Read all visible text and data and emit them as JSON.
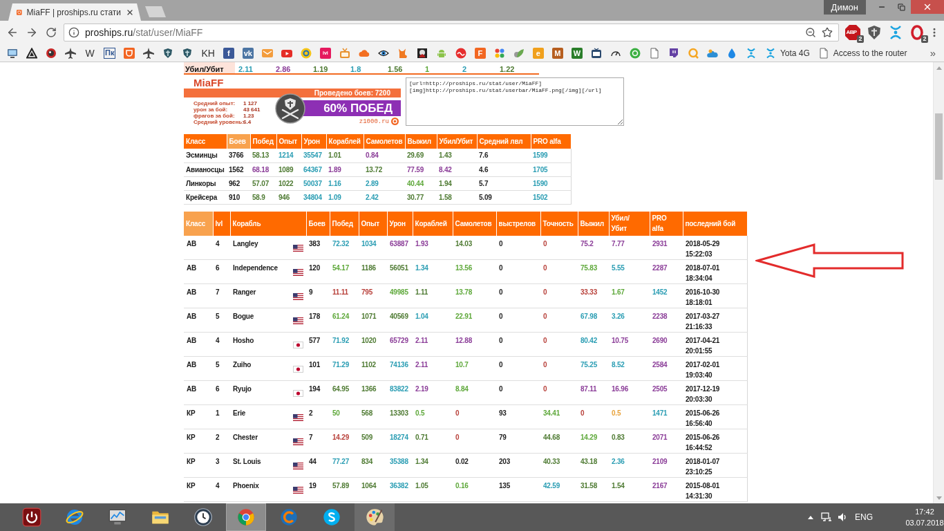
{
  "browser": {
    "tabs": [
      {
        "title": "MiaFF | proships.ru стати",
        "selected": true
      }
    ],
    "profile": "Димон",
    "address": {
      "host": "proships.ru",
      "path": "/stat/user/MiaFF"
    },
    "extensions": [
      {
        "kind": "badged",
        "label": "ABP",
        "badge": "2"
      },
      {
        "kind": "plain"
      },
      {
        "kind": "plain"
      },
      {
        "kind": "badged",
        "badge": "2"
      }
    ],
    "bookmarks": [
      {
        "kind": "icon"
      },
      {
        "kind": "icon"
      },
      {
        "kind": "icon"
      },
      {
        "kind": "icon"
      },
      {
        "kind": "letter",
        "label": "W"
      },
      {
        "kind": "boxed",
        "label": "Пк",
        "color": "#2c5390"
      },
      {
        "kind": "icon"
      },
      {
        "kind": "icon"
      },
      {
        "kind": "icon"
      },
      {
        "kind": "icon"
      },
      {
        "kind": "letter",
        "label": "KH"
      },
      {
        "kind": "tile",
        "label": "f",
        "color": "#3b5998"
      },
      {
        "kind": "tile",
        "label": "vk",
        "color": "#4c75a3"
      },
      {
        "kind": "icon"
      },
      {
        "kind": "icon"
      },
      {
        "kind": "icon"
      },
      {
        "kind": "tile",
        "label": "ivi",
        "color": "#e5195e"
      },
      {
        "kind": "icon"
      },
      {
        "kind": "icon"
      },
      {
        "kind": "icon"
      },
      {
        "kind": "icon"
      },
      {
        "kind": "icon"
      },
      {
        "kind": "icon"
      },
      {
        "kind": "icon"
      },
      {
        "kind": "tile",
        "label": "F",
        "color": "#f26722"
      },
      {
        "kind": "icon"
      },
      {
        "kind": "icon"
      },
      {
        "kind": "tile",
        "label": "e",
        "color": "#f0a01c"
      },
      {
        "kind": "tile",
        "label": "M",
        "color": "#b65e1f"
      },
      {
        "kind": "tile",
        "label": "W",
        "color": "#2a7d2a"
      },
      {
        "kind": "icon"
      },
      {
        "kind": "icon"
      },
      {
        "kind": "icon"
      },
      {
        "kind": "icon"
      },
      {
        "kind": "icon"
      },
      {
        "kind": "icon"
      },
      {
        "kind": "icon"
      },
      {
        "kind": "icon"
      },
      {
        "kind": "icon"
      },
      {
        "kind": "named",
        "label": "Yota 4G"
      },
      {
        "kind": "named",
        "label": "Access to the router"
      }
    ],
    "bookmarks_more": "»"
  },
  "kill_ratio_row": {
    "label": "Убил/Убит",
    "values": [
      {
        "text": "2.11",
        "color": "#2a9db3"
      },
      {
        "text": "2.86",
        "color": "#8b3d98"
      },
      {
        "text": "1.19",
        "color": "#4e7a32"
      },
      {
        "text": "1.8",
        "color": "#2a9db3"
      },
      {
        "text": "1.56",
        "color": "#4e7a32"
      },
      {
        "text": "1",
        "color": "#5ea83a"
      },
      {
        "text": "2",
        "color": "#2a9db3"
      },
      {
        "text": "1.22",
        "color": "#4e7a32"
      }
    ]
  },
  "userbar": {
    "name": "MiaFF",
    "battles": "Проведено боев: 7200",
    "stats": [
      {
        "label": "Средний опыт:",
        "value": "1 127"
      },
      {
        "label": "урон за бой:",
        "value": "43 641"
      },
      {
        "label": "фрагов за бой:",
        "value": "1.23"
      },
      {
        "label": "Средний уровень:",
        "value": "6.4"
      }
    ],
    "wins": "60% ПОБЕД",
    "site": "z1000.ru"
  },
  "bbcode": "[url=http://proships.ru/stat/user/MiaFF]\n[img]http://proships.ru/stat/userbar/MiaFF.png[/img][/url]",
  "class_table": {
    "columns": [
      {
        "label": "Класс",
        "sorted": false
      },
      {
        "label": "Боев",
        "sorted": true
      },
      {
        "label": "Побед",
        "sorted": false
      },
      {
        "label": "Опыт",
        "sorted": false
      },
      {
        "label": "Урон",
        "sorted": false
      },
      {
        "label": "Кораблей",
        "sorted": false
      },
      {
        "label": "Самолетов",
        "sorted": false
      },
      {
        "label": "Выжил",
        "sorted": false
      },
      {
        "label": "Убил/Убит",
        "sorted": false
      },
      {
        "label": "Средний лвл",
        "sorted": false
      },
      {
        "label": "PRO alfa",
        "sorted": false
      }
    ],
    "rows": [
      {
        "class": "Эсминцы",
        "battles": "3766",
        "stats": [
          {
            "text": "58.13",
            "color": "#4e7a32"
          },
          {
            "text": "1214",
            "color": "#2a9db3"
          },
          {
            "text": "35547",
            "color": "#2a9db3"
          },
          {
            "text": "1.01",
            "color": "#4e7a32"
          },
          {
            "text": "0.84",
            "color": "#8b3d98"
          },
          {
            "text": "29.69",
            "color": "#4e7a32"
          },
          {
            "text": "1.43",
            "color": "#4e7a32"
          },
          {
            "text": "7.6",
            "color": "#222222"
          },
          {
            "text": "1599",
            "color": "#2a9db3"
          }
        ]
      },
      {
        "class": "Авианосцы",
        "battles": "1562",
        "stats": [
          {
            "text": "68.18",
            "color": "#8b3d98"
          },
          {
            "text": "1089",
            "color": "#4e7a32"
          },
          {
            "text": "64367",
            "color": "#2a9db3"
          },
          {
            "text": "1.89",
            "color": "#8b3d98"
          },
          {
            "text": "13.72",
            "color": "#4e7a32"
          },
          {
            "text": "77.59",
            "color": "#8b3d98"
          },
          {
            "text": "8.42",
            "color": "#8b3d98"
          },
          {
            "text": "4.6",
            "color": "#222222"
          },
          {
            "text": "1705",
            "color": "#2a9db3"
          }
        ]
      },
      {
        "class": "Линкоры",
        "battles": "962",
        "stats": [
          {
            "text": "57.07",
            "color": "#4e7a32"
          },
          {
            "text": "1022",
            "color": "#4e7a32"
          },
          {
            "text": "50037",
            "color": "#2a9db3"
          },
          {
            "text": "1.16",
            "color": "#2a9db3"
          },
          {
            "text": "2.89",
            "color": "#2a9db3"
          },
          {
            "text": "40.44",
            "color": "#5ea83a"
          },
          {
            "text": "1.94",
            "color": "#4e7a32"
          },
          {
            "text": "5.7",
            "color": "#222222"
          },
          {
            "text": "1590",
            "color": "#2a9db3"
          }
        ]
      },
      {
        "class": "Крейсера",
        "battles": "910",
        "stats": [
          {
            "text": "58.9",
            "color": "#4e7a32"
          },
          {
            "text": "946",
            "color": "#4e7a32"
          },
          {
            "text": "34804",
            "color": "#2a9db3"
          },
          {
            "text": "1.09",
            "color": "#2a9db3"
          },
          {
            "text": "2.42",
            "color": "#2a9db3"
          },
          {
            "text": "30.77",
            "color": "#4e7a32"
          },
          {
            "text": "1.58",
            "color": "#4e7a32"
          },
          {
            "text": "5.09",
            "color": "#222222"
          },
          {
            "text": "1502",
            "color": "#2a9db3"
          }
        ]
      }
    ]
  },
  "ship_table": {
    "columns": [
      {
        "label": "Класс",
        "sorted": true
      },
      {
        "label": "lvl",
        "sorted": false
      },
      {
        "label": "Корабль",
        "sorted": false
      },
      {
        "label": "Боев",
        "sorted": false
      },
      {
        "label": "Побед",
        "sorted": false
      },
      {
        "label": "Опыт",
        "sorted": false
      },
      {
        "label": "Урон",
        "sorted": false
      },
      {
        "label": "Кораблей",
        "sorted": false
      },
      {
        "label": "Самолетов",
        "sorted": false
      },
      {
        "label": "выстрелов",
        "sorted": false
      },
      {
        "label": "Точность",
        "sorted": false
      },
      {
        "label": "Выжил",
        "sorted": false
      },
      {
        "label": "Убил/ Убит",
        "sorted": false
      },
      {
        "label": "PRO alfa",
        "sorted": false
      },
      {
        "label": "последний бой",
        "sorted": false
      }
    ],
    "rows": [
      {
        "class": "АВ",
        "lvl": "4",
        "ship": "Langley",
        "flag": {
          "kind": "us"
        },
        "battles": "383",
        "stats": [
          {
            "text": "72.32",
            "color": "#2a9db3"
          },
          {
            "text": "1034",
            "color": "#2a9db3"
          },
          {
            "text": "63887",
            "color": "#8b3d98"
          },
          {
            "text": "1.93",
            "color": "#8b3d98"
          },
          {
            "text": "14.03",
            "color": "#4e7a32"
          },
          {
            "text": "0",
            "color": "#222222"
          },
          {
            "text": "0",
            "color": "#b8403a"
          },
          {
            "text": "75.2",
            "color": "#8b3d98"
          },
          {
            "text": "7.77",
            "color": "#8b3d98"
          },
          {
            "text": "2931",
            "color": "#8b3d98"
          }
        ],
        "last_battle": "2018-05-29 15:22:03"
      },
      {
        "class": "АВ",
        "lvl": "6",
        "ship": "Independence",
        "flag": {
          "kind": "us"
        },
        "battles": "120",
        "stats": [
          {
            "text": "54.17",
            "color": "#5ea83a"
          },
          {
            "text": "1186",
            "color": "#4e7a32"
          },
          {
            "text": "56051",
            "color": "#4e7a32"
          },
          {
            "text": "1.34",
            "color": "#2a9db3"
          },
          {
            "text": "13.56",
            "color": "#5ea83a"
          },
          {
            "text": "0",
            "color": "#222222"
          },
          {
            "text": "0",
            "color": "#b8403a"
          },
          {
            "text": "75.83",
            "color": "#5ea83a"
          },
          {
            "text": "5.55",
            "color": "#2a9db3"
          },
          {
            "text": "2287",
            "color": "#8b3d98"
          }
        ],
        "last_battle": "2018-07-01 18:34:04"
      },
      {
        "class": "АВ",
        "lvl": "7",
        "ship": "Ranger",
        "flag": {
          "kind": "us"
        },
        "battles": "9",
        "stats": [
          {
            "text": "11.11",
            "color": "#b8403a"
          },
          {
            "text": "795",
            "color": "#b8403a"
          },
          {
            "text": "49985",
            "color": "#5ea83a"
          },
          {
            "text": "1.11",
            "color": "#4e7a32"
          },
          {
            "text": "13.78",
            "color": "#5ea83a"
          },
          {
            "text": "0",
            "color": "#222222"
          },
          {
            "text": "0",
            "color": "#b8403a"
          },
          {
            "text": "33.33",
            "color": "#b8403a"
          },
          {
            "text": "1.67",
            "color": "#5ea83a"
          },
          {
            "text": "1452",
            "color": "#2a9db3"
          }
        ],
        "last_battle": "2016-10-30 18:18:01"
      },
      {
        "class": "АВ",
        "lvl": "5",
        "ship": "Bogue",
        "flag": {
          "kind": "us"
        },
        "battles": "178",
        "stats": [
          {
            "text": "61.24",
            "color": "#5ea83a"
          },
          {
            "text": "1071",
            "color": "#4e7a32"
          },
          {
            "text": "40569",
            "color": "#4e7a32"
          },
          {
            "text": "1.04",
            "color": "#2a9db3"
          },
          {
            "text": "22.91",
            "color": "#5ea83a"
          },
          {
            "text": "0",
            "color": "#222222"
          },
          {
            "text": "0",
            "color": "#b8403a"
          },
          {
            "text": "67.98",
            "color": "#2a9db3"
          },
          {
            "text": "3.26",
            "color": "#2a9db3"
          },
          {
            "text": "2238",
            "color": "#8b3d98"
          }
        ],
        "last_battle": "2017-03-27 21:16:33"
      },
      {
        "class": "АВ",
        "lvl": "4",
        "ship": "Hosho",
        "flag": {
          "kind": "jp"
        },
        "battles": "577",
        "stats": [
          {
            "text": "71.92",
            "color": "#2a9db3"
          },
          {
            "text": "1020",
            "color": "#4e7a32"
          },
          {
            "text": "65729",
            "color": "#8b3d98"
          },
          {
            "text": "2.11",
            "color": "#8b3d98"
          },
          {
            "text": "12.88",
            "color": "#8b3d98"
          },
          {
            "text": "0",
            "color": "#222222"
          },
          {
            "text": "0",
            "color": "#b8403a"
          },
          {
            "text": "80.42",
            "color": "#2a9db3"
          },
          {
            "text": "10.75",
            "color": "#8b3d98"
          },
          {
            "text": "2690",
            "color": "#8b3d98"
          }
        ],
        "last_battle": "2017-04-21 20:01:55"
      },
      {
        "class": "АВ",
        "lvl": "5",
        "ship": "Zuiho",
        "flag": {
          "kind": "jp"
        },
        "battles": "101",
        "stats": [
          {
            "text": "71.29",
            "color": "#2a9db3"
          },
          {
            "text": "1102",
            "color": "#4e7a32"
          },
          {
            "text": "74136",
            "color": "#2a9db3"
          },
          {
            "text": "2.11",
            "color": "#8b3d98"
          },
          {
            "text": "10.7",
            "color": "#5ea83a"
          },
          {
            "text": "0",
            "color": "#222222"
          },
          {
            "text": "0",
            "color": "#b8403a"
          },
          {
            "text": "75.25",
            "color": "#2a9db3"
          },
          {
            "text": "8.52",
            "color": "#2a9db3"
          },
          {
            "text": "2584",
            "color": "#8b3d98"
          }
        ],
        "last_battle": "2017-02-01 19:03:40"
      },
      {
        "class": "АВ",
        "lvl": "6",
        "ship": "Ryujo",
        "flag": {
          "kind": "jp"
        },
        "battles": "194",
        "stats": [
          {
            "text": "64.95",
            "color": "#4e7a32"
          },
          {
            "text": "1366",
            "color": "#4e7a32"
          },
          {
            "text": "83822",
            "color": "#2a9db3"
          },
          {
            "text": "2.19",
            "color": "#8b3d98"
          },
          {
            "text": "8.84",
            "color": "#5ea83a"
          },
          {
            "text": "0",
            "color": "#222222"
          },
          {
            "text": "0",
            "color": "#b8403a"
          },
          {
            "text": "87.11",
            "color": "#8b3d98"
          },
          {
            "text": "16.96",
            "color": "#8b3d98"
          },
          {
            "text": "2505",
            "color": "#8b3d98"
          }
        ],
        "last_battle": "2017-12-19 20:03:30"
      },
      {
        "class": "КР",
        "lvl": "1",
        "ship": "Erie",
        "flag": {
          "kind": "us"
        },
        "battles": "2",
        "stats": [
          {
            "text": "50",
            "color": "#5ea83a"
          },
          {
            "text": "568",
            "color": "#4e7a32"
          },
          {
            "text": "13303",
            "color": "#4e7a32"
          },
          {
            "text": "0.5",
            "color": "#5ea83a"
          },
          {
            "text": "0",
            "color": "#b8403a"
          },
          {
            "text": "93",
            "color": "#222222"
          },
          {
            "text": "34.41",
            "color": "#5ea83a"
          },
          {
            "text": "0",
            "color": "#b8403a"
          },
          {
            "text": "0.5",
            "color": "#e8a23a"
          },
          {
            "text": "1471",
            "color": "#2a9db3"
          }
        ],
        "last_battle": "2015-06-26 16:56:40"
      },
      {
        "class": "КР",
        "lvl": "2",
        "ship": "Chester",
        "flag": {
          "kind": "us"
        },
        "battles": "7",
        "stats": [
          {
            "text": "14.29",
            "color": "#b8403a"
          },
          {
            "text": "509",
            "color": "#4e7a32"
          },
          {
            "text": "18274",
            "color": "#2a9db3"
          },
          {
            "text": "0.71",
            "color": "#4e7a32"
          },
          {
            "text": "0",
            "color": "#b8403a"
          },
          {
            "text": "79",
            "color": "#222222"
          },
          {
            "text": "44.68",
            "color": "#4e7a32"
          },
          {
            "text": "14.29",
            "color": "#5ea83a"
          },
          {
            "text": "0.83",
            "color": "#4e7a32"
          },
          {
            "text": "2071",
            "color": "#8b3d98"
          }
        ],
        "last_battle": "2015-06-26 16:44:52"
      },
      {
        "class": "КР",
        "lvl": "3",
        "ship": "St. Louis",
        "flag": {
          "kind": "us"
        },
        "battles": "44",
        "stats": [
          {
            "text": "77.27",
            "color": "#2a9db3"
          },
          {
            "text": "834",
            "color": "#4e7a32"
          },
          {
            "text": "35388",
            "color": "#2a9db3"
          },
          {
            "text": "1.34",
            "color": "#4e7a32"
          },
          {
            "text": "0.02",
            "color": "#222222"
          },
          {
            "text": "203",
            "color": "#222222"
          },
          {
            "text": "40.33",
            "color": "#4e7a32"
          },
          {
            "text": "43.18",
            "color": "#4e7a32"
          },
          {
            "text": "2.36",
            "color": "#2a9db3"
          },
          {
            "text": "2109",
            "color": "#8b3d98"
          }
        ],
        "last_battle": "2018-01-07 23:10:25"
      },
      {
        "class": "КР",
        "lvl": "4",
        "ship": "Phoenix",
        "flag": {
          "kind": "us"
        },
        "battles": "19",
        "stats": [
          {
            "text": "57.89",
            "color": "#4e7a32"
          },
          {
            "text": "1064",
            "color": "#4e7a32"
          },
          {
            "text": "36382",
            "color": "#2a9db3"
          },
          {
            "text": "1.05",
            "color": "#4e7a32"
          },
          {
            "text": "0.16",
            "color": "#5ea83a"
          },
          {
            "text": "135",
            "color": "#222222"
          },
          {
            "text": "42.59",
            "color": "#2a9db3"
          },
          {
            "text": "31.58",
            "color": "#4e7a32"
          },
          {
            "text": "1.54",
            "color": "#4e7a32"
          },
          {
            "text": "2167",
            "color": "#8b3d98"
          }
        ],
        "last_battle": "2015-08-01 14:31:30"
      }
    ]
  },
  "taskbar": {
    "apps": [
      {
        "selected": false,
        "running": false
      },
      {
        "selected": false,
        "running": false
      },
      {
        "selected": false,
        "running": false
      },
      {
        "selected": false,
        "running": false
      },
      {
        "selected": false,
        "running": false
      },
      {
        "selected": true,
        "running": true
      },
      {
        "selected": false,
        "running": false
      },
      {
        "selected": false,
        "running": false
      },
      {
        "selected": false,
        "running": true
      }
    ],
    "tray": {
      "language": "ENG",
      "time": "17:42",
      "date": "03.07.2018"
    }
  }
}
